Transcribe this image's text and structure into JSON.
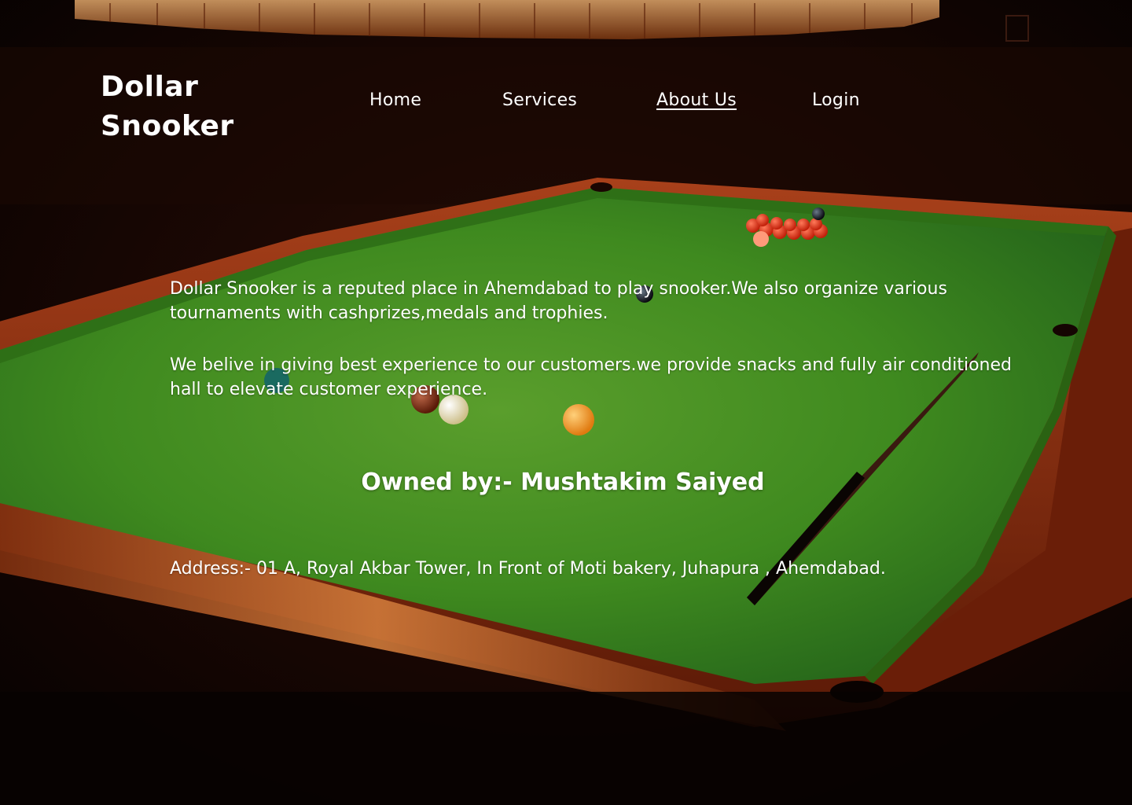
{
  "brand": {
    "line1": "Dollar",
    "line2": "Snooker"
  },
  "nav": {
    "home": "Home",
    "services": "Services",
    "about": "About Us",
    "login": "Login",
    "active": "about"
  },
  "about": {
    "paragraph1": "Dollar Snooker is a reputed place in Ahemdabad to play snooker.We also organize various tournaments with cashprizes,medals and trophies.",
    "paragraph2": "We belive in giving best experience to our customers.we provide snacks and fully air conditioned hall to elevate customer experience.",
    "owner": "Owned by:- Mushtakim Saiyed",
    "address": "Address:- 01 A, Royal Akbar Tower, In Front of Moti bakery, Juhapura , Ahemdabad."
  },
  "colors": {
    "text": "#ffffff",
    "felt": "#3f8a1f",
    "wood": "#8a2a0c",
    "background": "#0d0503"
  }
}
